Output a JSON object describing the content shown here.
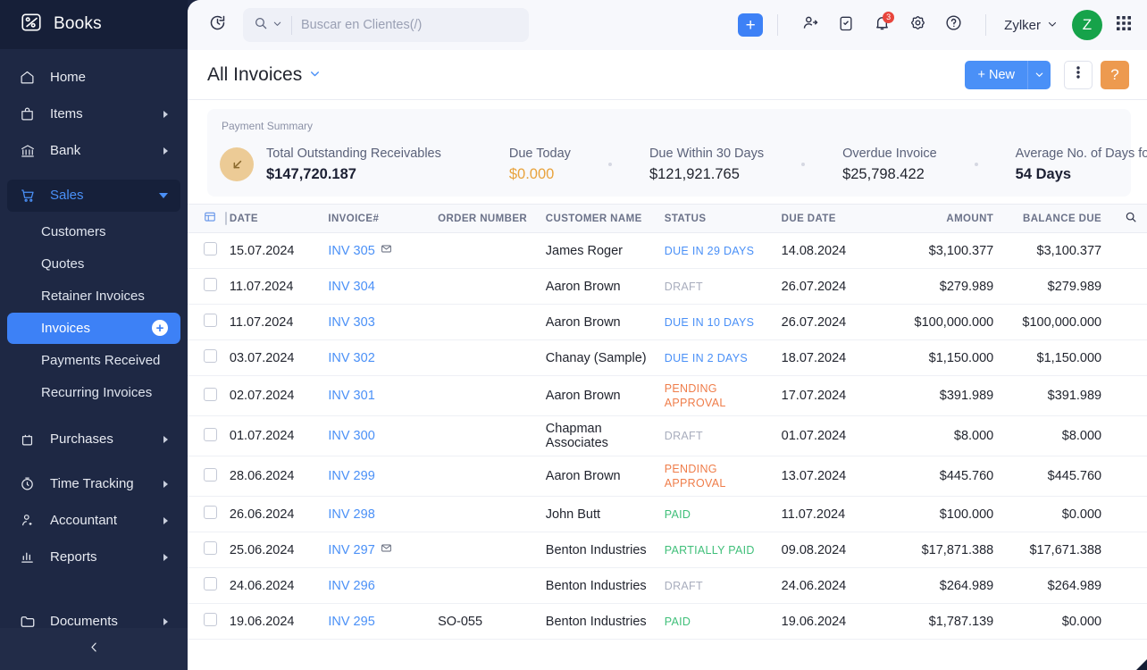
{
  "sidebar": {
    "brand": "Books",
    "items": [
      {
        "label": "Home",
        "icon": "home-icon",
        "arrow": false
      },
      {
        "label": "Items",
        "icon": "bag-icon",
        "arrow": true
      },
      {
        "label": "Bank",
        "icon": "bank-icon",
        "arrow": true
      }
    ],
    "sales": {
      "label": "Sales",
      "icon": "cart-icon",
      "expanded": true
    },
    "sales_children": [
      {
        "label": "Customers",
        "active": false
      },
      {
        "label": "Quotes",
        "active": false
      },
      {
        "label": "Retainer Invoices",
        "active": false
      },
      {
        "label": "Invoices",
        "active": true,
        "add": "+"
      },
      {
        "label": "Payments Received",
        "active": false
      },
      {
        "label": "Recurring Invoices",
        "active": false
      }
    ],
    "items_after": [
      {
        "label": "Purchases",
        "icon": "purchases-icon",
        "arrow": true
      },
      {
        "label": "Time Tracking",
        "icon": "timer-icon",
        "arrow": true
      },
      {
        "label": "Accountant",
        "icon": "accountant-icon",
        "arrow": true
      },
      {
        "label": "Reports",
        "icon": "reports-icon",
        "arrow": true
      },
      {
        "label": "Documents",
        "icon": "folder-icon",
        "arrow": true
      }
    ],
    "collapse_icon": "chevron-left-icon"
  },
  "topbar": {
    "refresh_icon": "refresh-clock-icon",
    "search_icon": "search-icon",
    "search_dropdown_icon": "chevron-down-icon",
    "search_placeholder": "Buscar en Clientes(/)",
    "search_value": "",
    "add_label": "+",
    "contacts_icon": "contacts-icon",
    "tasks_icon": "clipboard-check-icon",
    "notifications_icon": "bell-icon",
    "notifications_count": "3",
    "settings_icon": "gear-icon",
    "help_icon": "question-circle-icon",
    "org_name": "Zylker",
    "org_caret_icon": "chevron-down-icon",
    "avatar_initial": "Z",
    "apps_icon": "app-grid-icon"
  },
  "page": {
    "title": "All Invoices",
    "title_caret_icon": "chevron-down-icon",
    "new_button": "+ New",
    "new_caret_icon": "chevron-down-icon",
    "more_icon": "kebab-menu-icon",
    "help_button": "?"
  },
  "summary": {
    "heading": "Payment Summary",
    "icon": "arrow-down-left-icon",
    "cards": [
      {
        "label": "Total Outstanding Receivables",
        "value": "$147,720.187",
        "style": "bold"
      },
      {
        "label": "Due Today",
        "value": "$0.000",
        "style": "amber"
      },
      {
        "label": "Due Within 30 Days",
        "value": "$121,921.765",
        "style": "plain"
      },
      {
        "label": "Overdue Invoice",
        "value": "$25,798.422",
        "style": "plain"
      },
      {
        "label": "Average No. of Days for Getting Paid",
        "value": "54 Days",
        "style": "bold"
      }
    ]
  },
  "table": {
    "column_settings_icon": "column-settings-icon",
    "select_all_checkbox": "",
    "search_icon": "search-icon",
    "columns": [
      "DATE",
      "INVOICE#",
      "ORDER NUMBER",
      "CUSTOMER NAME",
      "STATUS",
      "DUE DATE",
      "AMOUNT",
      "BALANCE DUE"
    ],
    "rows": [
      {
        "date": "15.07.2024",
        "invoice": "INV 305",
        "mail_icon": true,
        "order": "",
        "customer": "James Roger",
        "status": "DUE IN 29 DAYS",
        "status_style": "blue",
        "due_date": "14.08.2024",
        "amount": "$3,100.377",
        "balance": "$3,100.377"
      },
      {
        "date": "11.07.2024",
        "invoice": "INV 304",
        "mail_icon": false,
        "order": "",
        "customer": "Aaron Brown",
        "status": "DRAFT",
        "status_style": "gray",
        "due_date": "26.07.2024",
        "amount": "$279.989",
        "balance": "$279.989"
      },
      {
        "date": "11.07.2024",
        "invoice": "INV 303",
        "mail_icon": false,
        "order": "",
        "customer": "Aaron Brown",
        "status": "DUE IN 10 DAYS",
        "status_style": "blue",
        "due_date": "26.07.2024",
        "amount": "$100,000.000",
        "balance": "$100,000.000"
      },
      {
        "date": "03.07.2024",
        "invoice": "INV 302",
        "mail_icon": false,
        "order": "",
        "customer": "Chanay (Sample)",
        "status": "DUE IN 2 DAYS",
        "status_style": "blue",
        "due_date": "18.07.2024",
        "amount": "$1,150.000",
        "balance": "$1,150.000"
      },
      {
        "date": "02.07.2024",
        "invoice": "INV 301",
        "mail_icon": false,
        "order": "",
        "customer": "Aaron Brown",
        "status": "PENDING APPROVAL",
        "status_style": "orange",
        "due_date": "17.07.2024",
        "amount": "$391.989",
        "balance": "$391.989"
      },
      {
        "date": "01.07.2024",
        "invoice": "INV 300",
        "mail_icon": false,
        "order": "",
        "customer": "Chapman Associates",
        "status": "DRAFT",
        "status_style": "gray",
        "due_date": "01.07.2024",
        "amount": "$8.000",
        "balance": "$8.000"
      },
      {
        "date": "28.06.2024",
        "invoice": "INV 299",
        "mail_icon": false,
        "order": "",
        "customer": "Aaron Brown",
        "status": "PENDING APPROVAL",
        "status_style": "orange",
        "due_date": "13.07.2024",
        "amount": "$445.760",
        "balance": "$445.760"
      },
      {
        "date": "26.06.2024",
        "invoice": "INV 298",
        "mail_icon": false,
        "order": "",
        "customer": "John Butt",
        "status": "PAID",
        "status_style": "green",
        "due_date": "11.07.2024",
        "amount": "$100.000",
        "balance": "$0.000"
      },
      {
        "date": "25.06.2024",
        "invoice": "INV 297",
        "mail_icon": true,
        "order": "",
        "customer": "Benton Industries",
        "status": "PARTIALLY PAID",
        "status_style": "green",
        "due_date": "09.08.2024",
        "amount": "$17,871.388",
        "balance": "$17,671.388"
      },
      {
        "date": "24.06.2024",
        "invoice": "INV 296",
        "mail_icon": false,
        "order": "",
        "customer": "Benton Industries",
        "status": "DRAFT",
        "status_style": "gray",
        "due_date": "24.06.2024",
        "amount": "$264.989",
        "balance": "$264.989"
      },
      {
        "date": "19.06.2024",
        "invoice": "INV 295",
        "mail_icon": false,
        "order": "SO-055",
        "customer": "Benton Industries",
        "status": "PAID",
        "status_style": "green",
        "due_date": "19.06.2024",
        "amount": "$1,787.139",
        "balance": "$0.000"
      }
    ]
  },
  "colors": {
    "accent": "#4a90f7",
    "sidebar_bg": "#1e2844",
    "active_item": "#3d81f6",
    "amber": "#e8a33d",
    "orange": "#ef7d4a",
    "green": "#3fbf79",
    "avatar_green": "#16a34a",
    "help_orange": "#ed9a4f"
  }
}
